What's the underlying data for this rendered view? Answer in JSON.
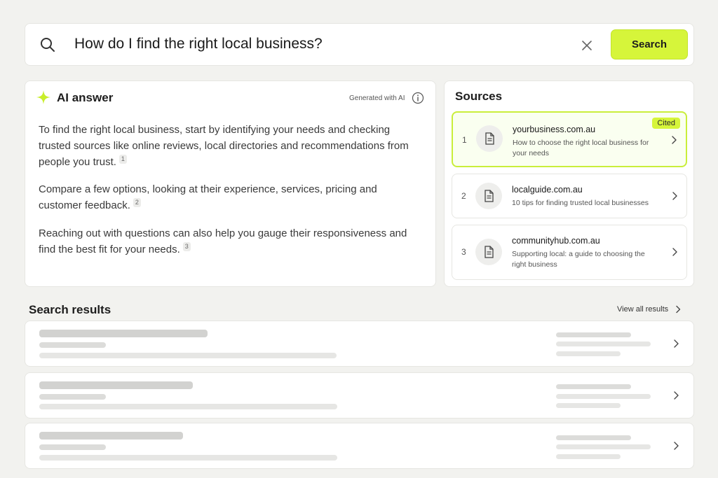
{
  "search": {
    "query": "How do I find the right local business?",
    "button_label": "Search"
  },
  "ai_answer": {
    "title": "AI answer",
    "generated_label": "Generated with AI",
    "accent_color": "#d6f53a",
    "paragraphs": [
      {
        "text": "To find the right local business, start by identifying your needs and checking trusted sources like online reviews, local directories and recommendations from people you trust.",
        "citation": "1"
      },
      {
        "text": "Compare a few options, looking at their experience, services, pricing and customer feedback.",
        "citation": "2"
      },
      {
        "text": "Reaching out with questions can also help you gauge their responsiveness and find the best fit for your needs.",
        "citation": "3"
      }
    ]
  },
  "sources": {
    "title": "Sources",
    "items": [
      {
        "number": "1",
        "domain": "yourbusiness.com.au",
        "description": "How to choose the right local business for your needs",
        "badge": "Cited",
        "icon": "document-icon"
      },
      {
        "number": "2",
        "domain": "localguide.com.au",
        "description": "10 tips for finding trusted local businesses",
        "icon": "document-icon"
      },
      {
        "number": "3",
        "domain": "communityhub.com.au",
        "description": "Supporting local: a guide to choosing the right business",
        "icon": "document-icon"
      }
    ]
  },
  "results": {
    "title": "Search results",
    "view_all_label": "View all results"
  }
}
